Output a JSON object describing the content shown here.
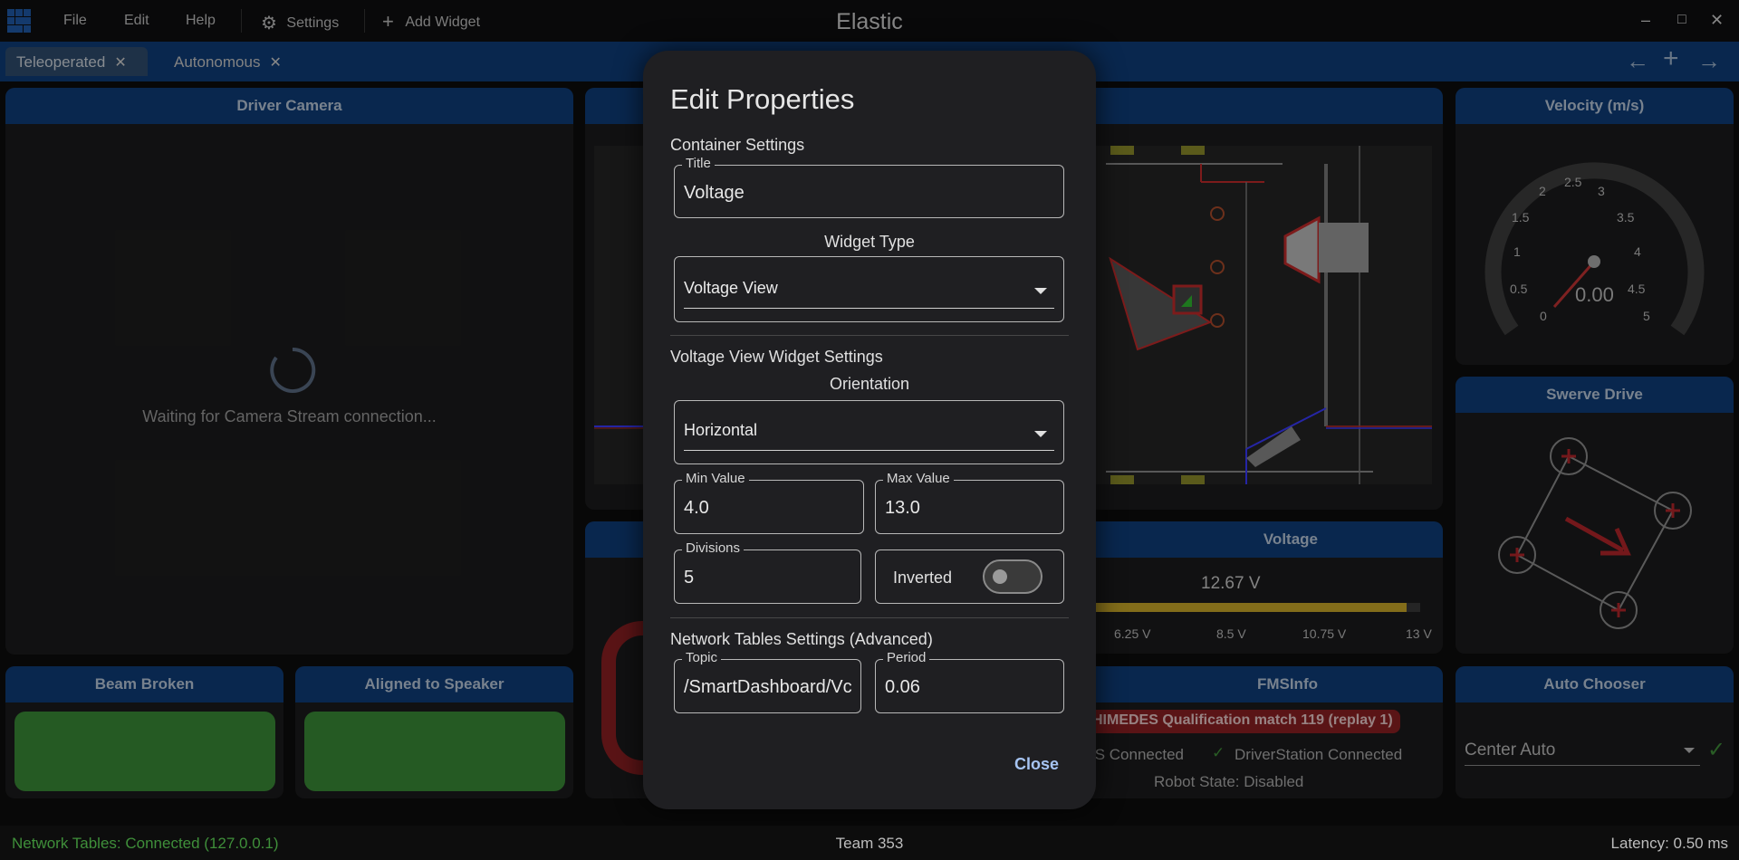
{
  "titlebar": {
    "app_title": "Elastic",
    "menu": [
      "File",
      "Edit",
      "Help"
    ],
    "settings_label": "Settings",
    "add_widget_label": "Add Widget",
    "minimize": "–",
    "maximize": "□",
    "close": "✕"
  },
  "tabs": [
    {
      "label": "Teleoperated",
      "active": true
    },
    {
      "label": "Autonomous",
      "active": false
    }
  ],
  "nav": {
    "back": "←",
    "add": "+",
    "forward": "→"
  },
  "widgets": {
    "driver_camera": {
      "title": "Driver Camera",
      "status": "Waiting for Camera Stream connection..."
    },
    "velocity": {
      "title": "Velocity (m/s)",
      "value": "0.00",
      "ticks": [
        "0",
        "0.5",
        "1",
        "1.5",
        "2",
        "2.5",
        "3",
        "3.5",
        "4",
        "4.5",
        "5"
      ]
    },
    "swerve": {
      "title": "Swerve Drive"
    },
    "voltage": {
      "title": "Voltage",
      "value": "12.67 V",
      "ticks": [
        "6.25 V",
        "8.5 V",
        "10.75 V",
        "13 V"
      ],
      "fill_fraction": 0.96
    },
    "fms": {
      "title": "FMSInfo",
      "match": "HIMEDES Qualification match 119 (replay 1)",
      "fms_status": "IS Connected",
      "ds_status": "DriverStation Connected",
      "robot_state": "Robot State: Disabled"
    },
    "beam": {
      "title": "Beam Broken"
    },
    "aligned": {
      "title": "Aligned to Speaker"
    },
    "auto": {
      "title": "Auto Chooser",
      "selected": "Center Auto"
    }
  },
  "dialog": {
    "title": "Edit Properties",
    "container_settings": "Container Settings",
    "title_field": {
      "label": "Title",
      "value": "Voltage"
    },
    "widget_type_label": "Widget Type",
    "widget_type_value": "Voltage View",
    "widget_settings": "Voltage View Widget Settings",
    "orientation_label": "Orientation",
    "orientation_value": "Horizontal",
    "min_value": {
      "label": "Min Value",
      "value": "4.0"
    },
    "max_value": {
      "label": "Max Value",
      "value": "13.0"
    },
    "divisions": {
      "label": "Divisions",
      "value": "5"
    },
    "inverted_label": "Inverted",
    "inverted": false,
    "nt_settings": "Network Tables Settings (Advanced)",
    "topic": {
      "label": "Topic",
      "value": "/SmartDashboard/Vc"
    },
    "period": {
      "label": "Period",
      "value": "0.06"
    },
    "close_label": "Close"
  },
  "statusbar": {
    "nt_status": "Network Tables: Connected (127.0.0.1)",
    "team": "Team 353",
    "latency": "Latency: 0.50 ms"
  },
  "colors": {
    "accent": "#0f3c78",
    "ok": "#3a8a36",
    "alert": "#b3262a"
  }
}
